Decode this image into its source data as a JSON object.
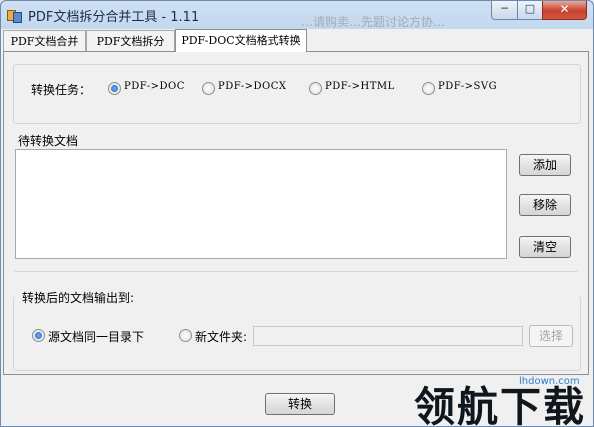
{
  "window": {
    "title": "PDF文档拆分合并工具 - 1.11",
    "watermark": "…请购卖…先题讨论方协…",
    "controls": {
      "minimize": "─",
      "maximize": "□",
      "close": "✕"
    }
  },
  "tabs": [
    {
      "label": "PDF文档合并"
    },
    {
      "label": "PDF文档拆分"
    },
    {
      "label": "PDF-DOC文档格式转换"
    }
  ],
  "active_tab": 2,
  "task": {
    "label": "转换任务：",
    "options": [
      {
        "label": "PDF->DOC",
        "checked": true
      },
      {
        "label": "PDF->DOCX",
        "checked": false
      },
      {
        "label": "PDF->HTML",
        "checked": false
      },
      {
        "label": "PDF->SVG",
        "checked": false
      }
    ]
  },
  "docs": {
    "label": "待转换文档",
    "items": [],
    "add_label": "添加",
    "remove_label": "移除",
    "clear_label": "清空"
  },
  "output": {
    "label": "转换后的文档输出到:",
    "same_dir_label": "源文档同一目录下",
    "same_dir_checked": true,
    "new_folder_label": "新文件夹:",
    "new_folder_checked": false,
    "folder_value": "",
    "browse_label": "选择"
  },
  "convert_label": "转换",
  "brand": {
    "text": "领航下载",
    "url": "lhdown.com"
  }
}
